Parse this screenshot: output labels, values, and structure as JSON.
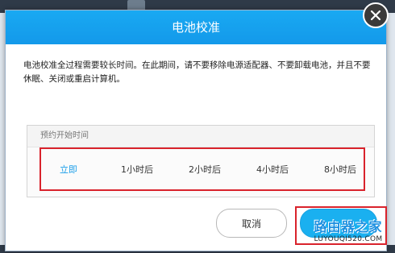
{
  "dialog": {
    "title": "电池校准",
    "description": "电池校准全过程需要较长时间。在此期间，请不要移除电源适配器、不要卸载电池，并且不要休眠、关闭或重启计算机。"
  },
  "schedule": {
    "heading": "预约开始时间",
    "options": [
      "立即",
      "1小时后",
      "2小时后",
      "4小时后",
      "8小时后"
    ],
    "selected": "立即"
  },
  "buttons": {
    "cancel": "取消"
  },
  "watermark": {
    "main": "路由器之家",
    "sub": "LUYOUQI520.COM"
  },
  "colors": {
    "titlebar": "#19a9f2",
    "accent": "#1a9ee9",
    "highlight": "#d9232c"
  }
}
